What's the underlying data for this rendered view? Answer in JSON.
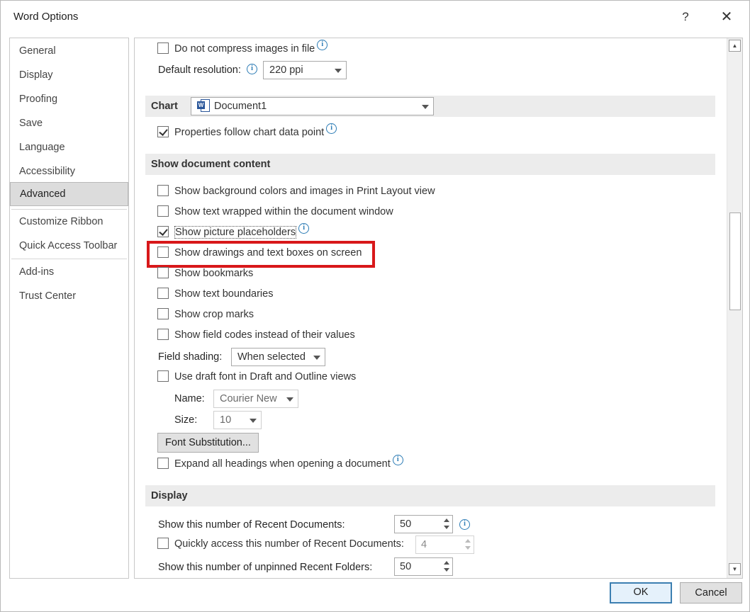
{
  "window": {
    "title": "Word Options",
    "help_label": "?",
    "close_label": "✕"
  },
  "sidebar": {
    "items": [
      {
        "label": "General"
      },
      {
        "label": "Display"
      },
      {
        "label": "Proofing"
      },
      {
        "label": "Save"
      },
      {
        "label": "Language"
      },
      {
        "label": "Accessibility"
      },
      {
        "label": "Advanced",
        "selected": true
      },
      {
        "label": "Customize Ribbon"
      },
      {
        "label": "Quick Access Toolbar"
      },
      {
        "label": "Add-ins"
      },
      {
        "label": "Trust Center"
      }
    ]
  },
  "image": {
    "no_compress_label": "Do not compress images in file",
    "no_compress_checked": false,
    "resolution_label": "Default resolution:",
    "resolution_value": "220 ppi"
  },
  "chart": {
    "section_title": "Chart",
    "document_value": "Document1",
    "doc_icon_letter": "W",
    "properties_follow_label": "Properties follow chart data point",
    "properties_follow_checked": true
  },
  "show_content": {
    "section_title": "Show document content",
    "options": [
      {
        "label": "Show background colors and images in Print Layout view",
        "checked": false
      },
      {
        "label": "Show text wrapped within the document window",
        "checked": false
      },
      {
        "label": "Show picture placeholders",
        "checked": true
      },
      {
        "label": "Show drawings and text boxes on screen",
        "checked": false
      },
      {
        "label": "Show bookmarks",
        "checked": false
      },
      {
        "label": "Show text boundaries",
        "checked": false
      },
      {
        "label": "Show crop marks",
        "checked": false
      },
      {
        "label": "Show field codes instead of their values",
        "checked": false
      }
    ],
    "field_shading_label": "Field shading:",
    "field_shading_value": "When selected",
    "draft_font_label": "Use draft font in Draft and Outline views",
    "draft_font_checked": false,
    "name_label": "Name:",
    "name_value": "Courier New",
    "size_label": "Size:",
    "size_value": "10",
    "font_substitution_label": "Font Substitution...",
    "expand_headings_label": "Expand all headings when opening a document",
    "expand_headings_checked": false
  },
  "display": {
    "section_title": "Display",
    "recent_docs_label": "Show this number of Recent Documents:",
    "recent_docs_value": "50",
    "quick_access_label": "Quickly access this number of Recent Documents:",
    "quick_access_value": "4",
    "quick_access_checked": false,
    "recent_folders_label": "Show this number of unpinned Recent Folders:",
    "recent_folders_value": "50"
  },
  "footer": {
    "ok_label": "OK",
    "cancel_label": "Cancel"
  },
  "colors": {
    "highlight": "#d8181a",
    "info": "#2b7bb5",
    "selected_nav": "#dcdcdc"
  },
  "icons": {
    "info": "info-circle-icon",
    "dropdown": "chevron-down-icon",
    "spin": "spin-arrows-icon",
    "scroll_up": "scroll-up-arrow-icon",
    "scroll_down": "scroll-down-arrow-icon"
  }
}
